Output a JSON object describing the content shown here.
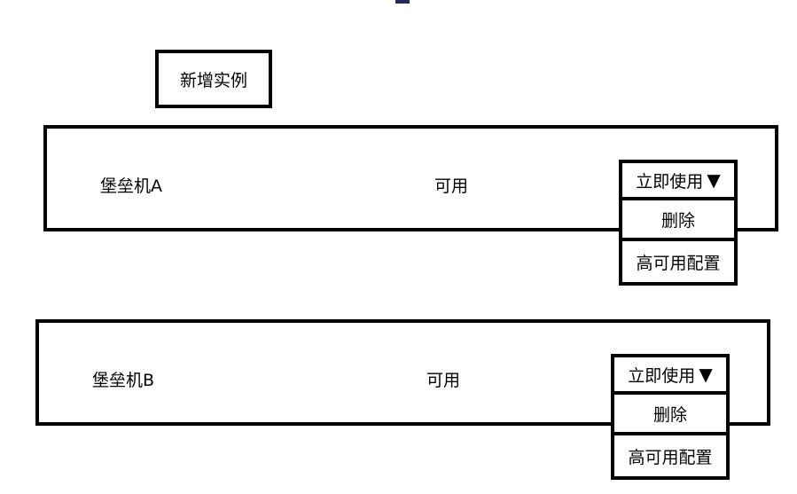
{
  "toolbar": {
    "new_instance_label": "新增实例"
  },
  "instances": [
    {
      "name": "堡垒机A",
      "status": "可用",
      "menu": {
        "toggle_label": "立即使用",
        "arrow": "▼",
        "items": [
          "删除",
          "高可用配置"
        ]
      }
    },
    {
      "name": "堡垒机B",
      "status": "可用",
      "menu": {
        "toggle_label": "立即使用",
        "arrow": "▼",
        "items": [
          "删除",
          "高可用配置"
        ]
      }
    }
  ],
  "colors": {
    "border": "#000000",
    "background": "#ffffff",
    "top_mark": "#2a2a5a"
  }
}
